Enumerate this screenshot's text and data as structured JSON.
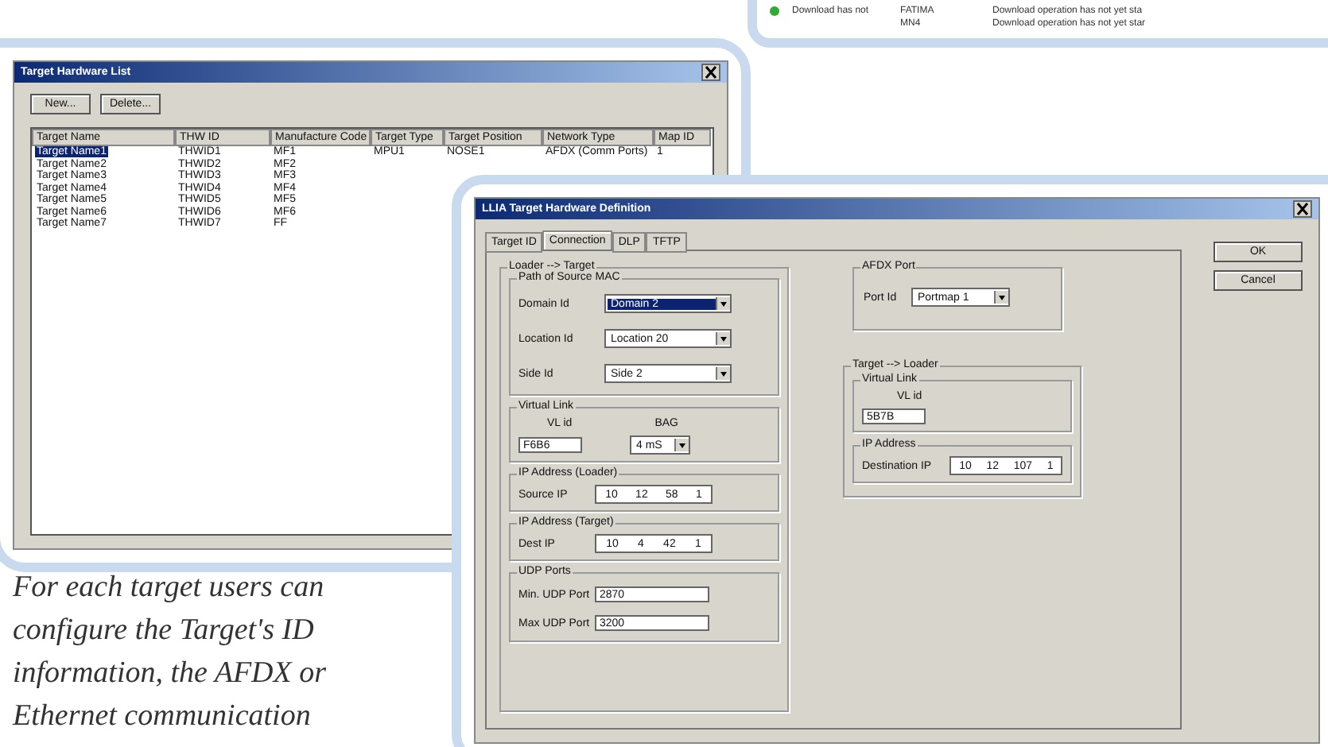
{
  "back_window": {
    "rows": [
      {
        "icon": true,
        "cells": [
          "Download has not",
          "FATIMA",
          "Download operation has not yet sta"
        ]
      },
      {
        "icon": false,
        "cells": [
          "",
          "MN4",
          "Download operation has not yet star"
        ]
      }
    ]
  },
  "target_list": {
    "title": "Target Hardware List",
    "buttons": [
      "New...",
      "Delete..."
    ],
    "columns": [
      "Target Name",
      "THW ID",
      "Manufacture Code",
      "Target Type",
      "Target Position",
      "Network Type",
      "Map ID"
    ],
    "rows": [
      {
        "selected": true,
        "cells": [
          "Target Name1",
          "THWID1",
          "MF1",
          "MPU1",
          "NOSE1",
          "AFDX (Comm Ports)",
          "1"
        ]
      },
      {
        "selected": false,
        "cells": [
          "Target Name2",
          "THWID2",
          "MF2",
          "",
          "",
          "",
          ""
        ]
      },
      {
        "selected": false,
        "cells": [
          "Target Name3",
          "THWID3",
          "MF3",
          "",
          "",
          "",
          ""
        ]
      },
      {
        "selected": false,
        "cells": [
          "Target Name4",
          "THWID4",
          "MF4",
          "",
          "",
          "",
          ""
        ]
      },
      {
        "selected": false,
        "cells": [
          "Target Name5",
          "THWID5",
          "MF5",
          "",
          "",
          "",
          ""
        ]
      },
      {
        "selected": false,
        "cells": [
          "Target Name6",
          "THWID6",
          "MF6",
          "",
          "",
          "",
          ""
        ]
      },
      {
        "selected": false,
        "cells": [
          "Target Name7",
          "THWID7",
          "FF",
          "",
          "",
          "",
          ""
        ]
      }
    ]
  },
  "dialog": {
    "title": "LLIA Target Hardware Definition",
    "tabs": [
      {
        "label": "Target ID",
        "selected": false
      },
      {
        "label": "Connection",
        "selected": true
      },
      {
        "label": "DLP",
        "selected": false
      },
      {
        "label": "TFTP",
        "selected": false
      }
    ],
    "buttons": [
      "OK",
      "Cancel"
    ],
    "loader_to_target": {
      "title": "Loader --> Target",
      "path": {
        "title": "Path of Source MAC",
        "fields": [
          {
            "label": "Domain Id",
            "value": "Domain 2",
            "focused": true
          },
          {
            "label": "Location Id",
            "value": "Location 20",
            "focused": false
          },
          {
            "label": "Side Id",
            "value": "Side 2",
            "focused": false
          }
        ]
      },
      "virtual_link": {
        "title": "Virtual Link",
        "vl_label": "VL id",
        "vl_value": "F6B6",
        "bag_label": "BAG",
        "bag_value": "4 mS"
      },
      "ip_loader": {
        "title": "IP Address (Loader)",
        "label": "Source IP",
        "octets": [
          "10",
          "12",
          "58",
          "1"
        ]
      },
      "ip_target": {
        "title": "IP Address (Target)",
        "label": "Dest IP",
        "octets": [
          "10",
          "4",
          "42",
          "1"
        ]
      },
      "udp": {
        "title": "UDP Ports",
        "fields": [
          {
            "label": "Min. UDP Port",
            "value": "2870"
          },
          {
            "label": "Max UDP Port",
            "value": "3200"
          }
        ]
      }
    },
    "afdx_port": {
      "title": "AFDX Port",
      "label": "Port Id",
      "value": "Portmap 1"
    },
    "target_to_loader": {
      "title": "Target --> Loader",
      "virtual_link": {
        "title": "Virtual Link",
        "vl_label": "VL id",
        "vl_value": "5B7B"
      },
      "ip": {
        "title": "IP Address",
        "label": "Destination IP",
        "octets": [
          "10",
          "12",
          "107",
          "1"
        ]
      }
    }
  },
  "caption": "For each target users can configure the Target's ID information, the AFDX or Ethernet communication"
}
